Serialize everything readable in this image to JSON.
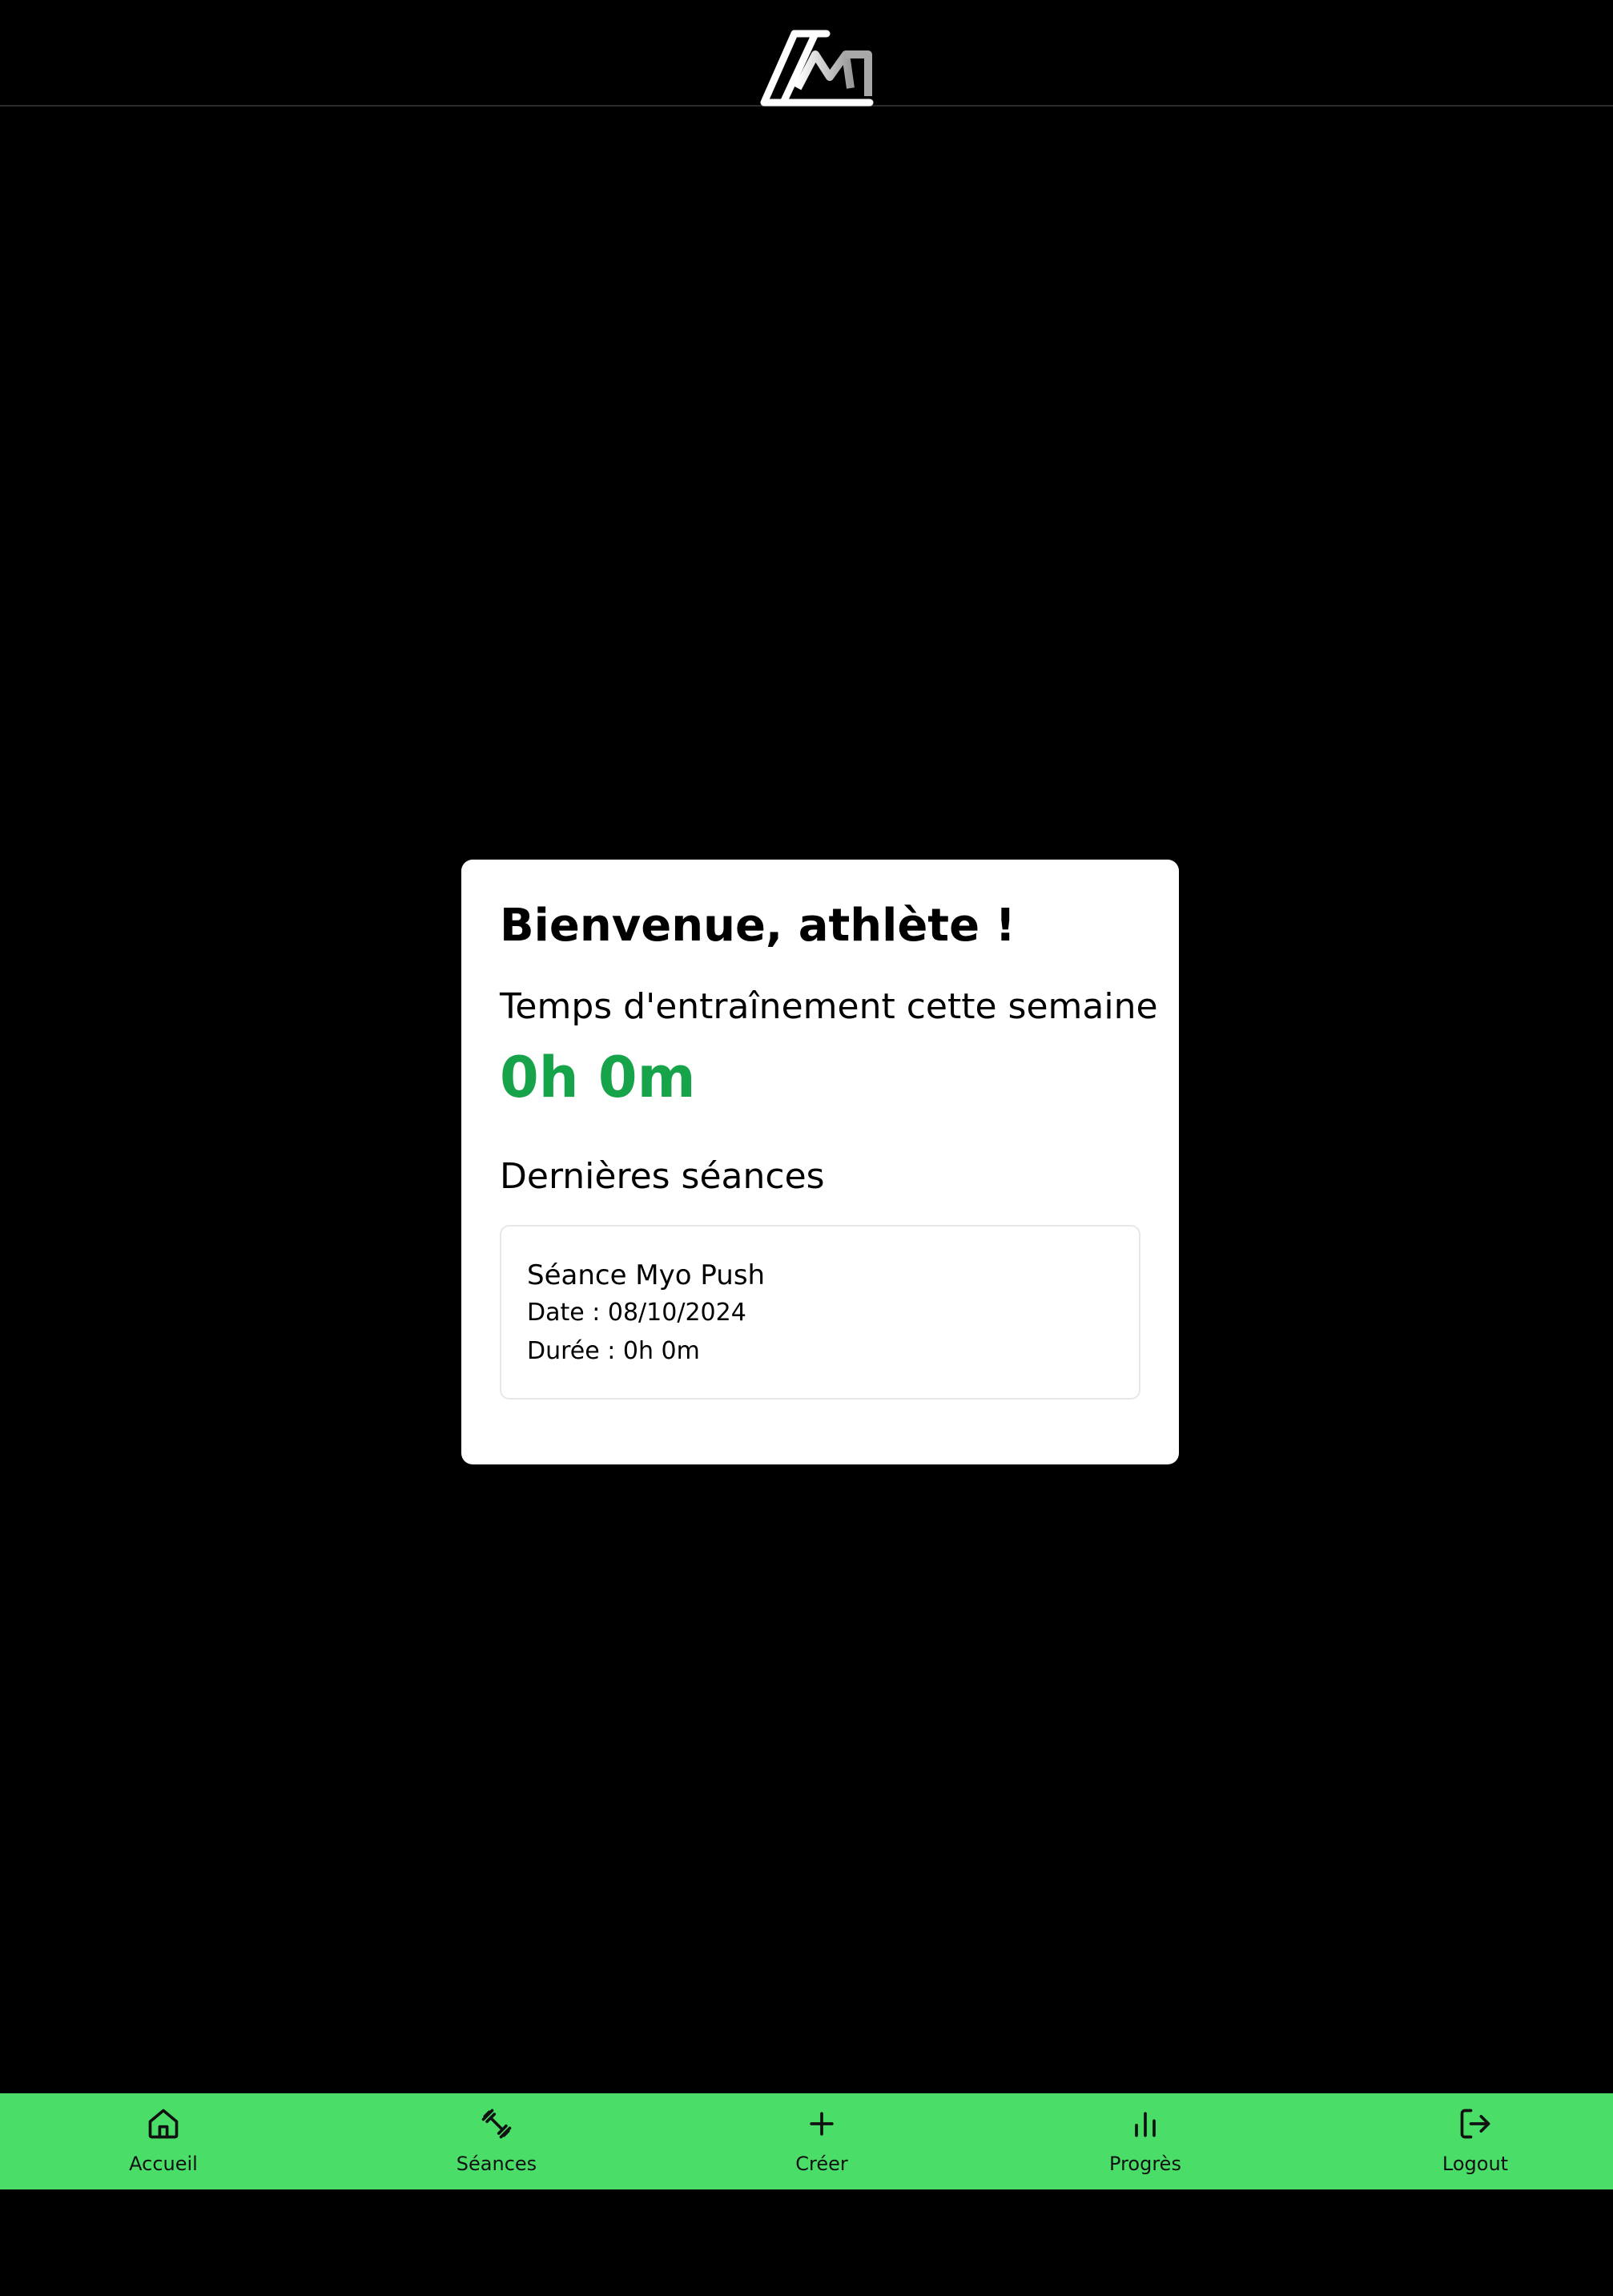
{
  "header": {
    "logo_icon": "brand-logo"
  },
  "dashboard": {
    "welcome": "Bienvenue, athlète !",
    "week_label": "Temps d'entraînement cette semaine",
    "week_value": "0h 0m",
    "week_value_color": "#16a34a",
    "recent_title": "Dernières séances",
    "sessions": [
      {
        "name": "Séance Myo Push",
        "date": "Date : 08/10/2024",
        "duration": "Durée : 0h 0m"
      }
    ]
  },
  "bottom_nav": {
    "background": "#4ade68",
    "items": [
      {
        "label": "Accueil",
        "icon": "home-icon"
      },
      {
        "label": "Séances",
        "icon": "dumbbell-icon"
      },
      {
        "label": "Créer",
        "icon": "plus-icon"
      },
      {
        "label": "Progrès",
        "icon": "bar-chart-icon"
      },
      {
        "label": "Logout",
        "icon": "logout-icon"
      }
    ]
  }
}
